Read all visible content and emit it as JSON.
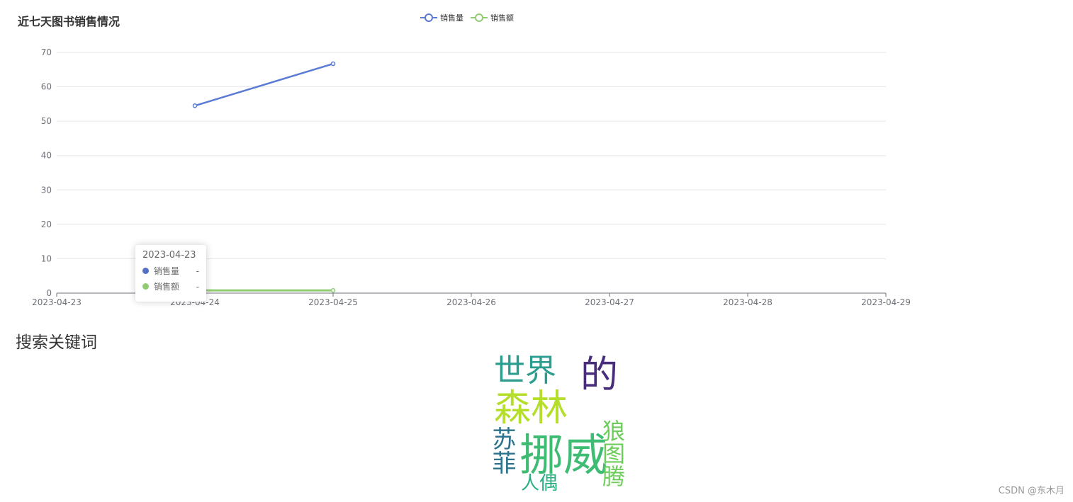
{
  "chart": {
    "title": "近七天图书销售情况",
    "legend": [
      {
        "name": "销售量",
        "color": "#5b7bd5"
      },
      {
        "name": "销售额",
        "color": "#91cc75"
      }
    ]
  },
  "chart_data": {
    "type": "line",
    "title": "近七天图书销售情况",
    "x": [
      "2023-04-23",
      "2023-04-24",
      "2023-04-25",
      "2023-04-26",
      "2023-04-27",
      "2023-04-28",
      "2023-04-29"
    ],
    "ylim": [
      0,
      70
    ],
    "yticks": [
      0,
      10,
      20,
      30,
      40,
      50,
      60,
      70
    ],
    "grid": true,
    "legend_position": "top-center",
    "series": [
      {
        "name": "销售量",
        "color": "#5b7bd5",
        "values": [
          null,
          54.5,
          66.7,
          null,
          null,
          null,
          null
        ]
      },
      {
        "name": "销售额",
        "color": "#91cc75",
        "values": [
          null,
          0.8,
          0.8,
          null,
          null,
          null,
          null
        ]
      }
    ]
  },
  "tooltip": {
    "date": "2023-04-23",
    "rows": [
      {
        "name": "销售量",
        "value": "-",
        "color": "#5470c6"
      },
      {
        "name": "销售额",
        "value": "-",
        "color": "#91cc75"
      }
    ]
  },
  "keywords": {
    "title": "搜索关键词",
    "words": [
      {
        "text": "世界",
        "color": "#2a9d8f"
      },
      {
        "text": "的",
        "color": "#472d7b"
      },
      {
        "text": "森林",
        "color": "#b5de2b"
      },
      {
        "text": "苏菲",
        "color": "#2c728e"
      },
      {
        "text": "挪威",
        "color": "#3fbc73"
      },
      {
        "text": "狼图腾",
        "color": "#6ccd5a"
      },
      {
        "text": "人偶",
        "color": "#28ae80"
      }
    ]
  },
  "watermark": "CSDN @东木月"
}
